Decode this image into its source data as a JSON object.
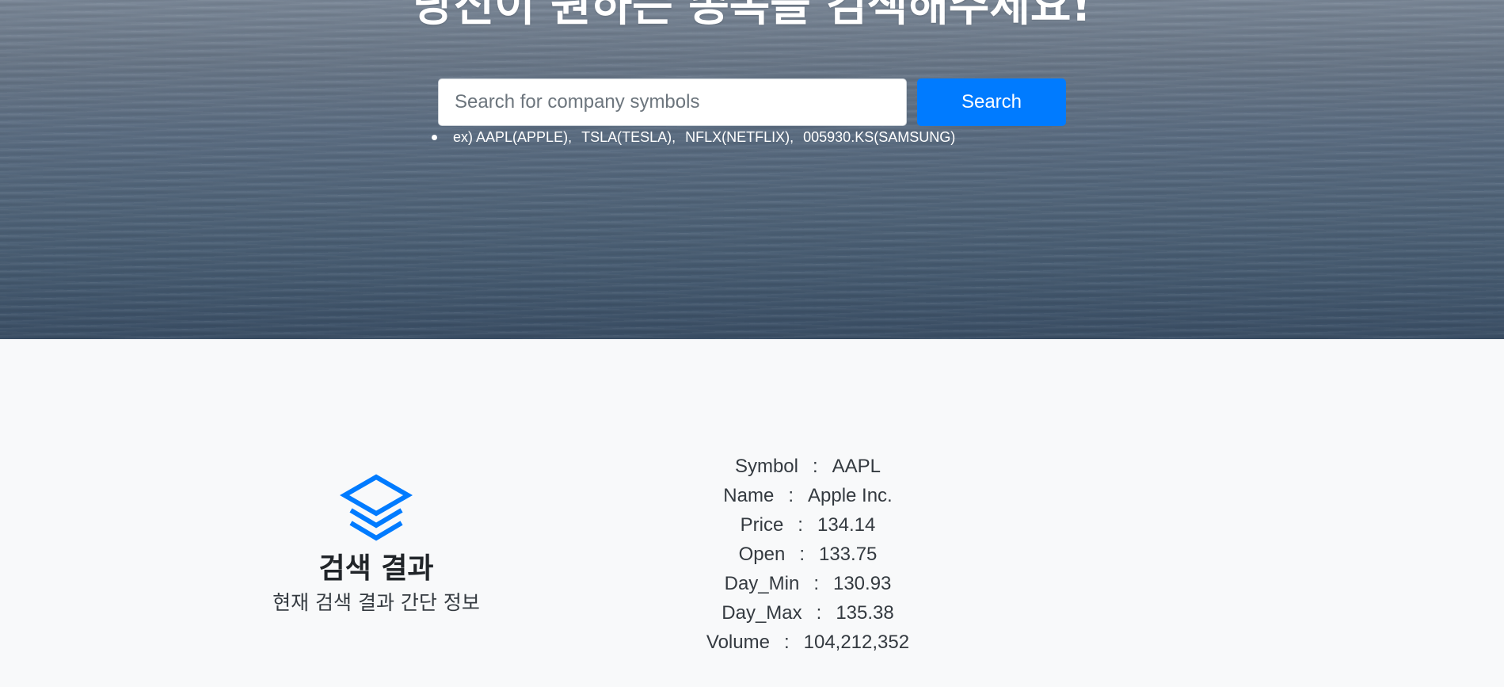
{
  "hero": {
    "title": "당신이 원하는 종목을 검색해주세요!",
    "search": {
      "placeholder": "Search for company symbols",
      "value": ""
    },
    "search_button_label": "Search",
    "examples": [
      "ex) AAPL(APPLE),",
      "TSLA(TESLA),",
      "NFLX(NETFLIX),",
      "005930.KS(SAMSUNG)"
    ]
  },
  "result": {
    "icon": "layers-icon",
    "title": "검색 결과",
    "subtitle": "현재 검색 결과 간단 정보",
    "separator": ":",
    "fields": [
      {
        "label": "Symbol",
        "value": "AAPL"
      },
      {
        "label": "Name",
        "value": "Apple Inc."
      },
      {
        "label": "Price",
        "value": "134.14"
      },
      {
        "label": "Open",
        "value": "133.75"
      },
      {
        "label": "Day_Min",
        "value": "130.93"
      },
      {
        "label": "Day_Max",
        "value": "135.38"
      },
      {
        "label": "Volume",
        "value": "104,212,352"
      }
    ]
  },
  "colors": {
    "accent": "#007bff",
    "section_background": "#f8f9fa",
    "text_dark": "#212529"
  }
}
